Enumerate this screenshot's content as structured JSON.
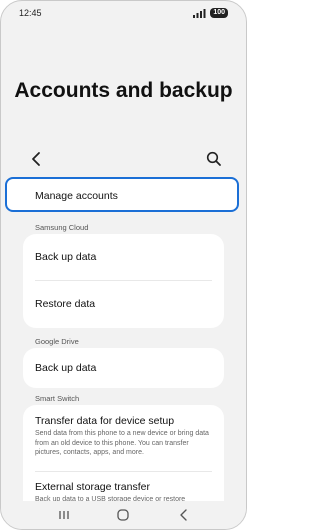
{
  "status_bar": {
    "time": "12:45",
    "battery": "100"
  },
  "page_title": "Accounts and backup",
  "items": {
    "manage_accounts": "Manage accounts",
    "samsung_cloud_header": "Samsung Cloud",
    "back_up_data": "Back up data",
    "restore_data": "Restore data",
    "google_drive_header": "Google Drive",
    "google_back_up_data": "Back up data",
    "smart_switch_header": "Smart Switch",
    "transfer_title": "Transfer data for device setup",
    "transfer_desc": "Send data from this phone to a new device or bring data from an old device to this phone. You can transfer pictures, contacts, apps, and more.",
    "external_title": "External storage transfer",
    "external_desc": "Back up data to a USB storage device or restore"
  },
  "icons": [
    "signal-icon",
    "battery-icon",
    "back-icon",
    "search-icon",
    "recents-icon",
    "home-icon",
    "nav-back-icon"
  ],
  "colors": {
    "highlight": "#1b6fd6",
    "background": "#f2f2f2",
    "card": "#ffffff"
  }
}
